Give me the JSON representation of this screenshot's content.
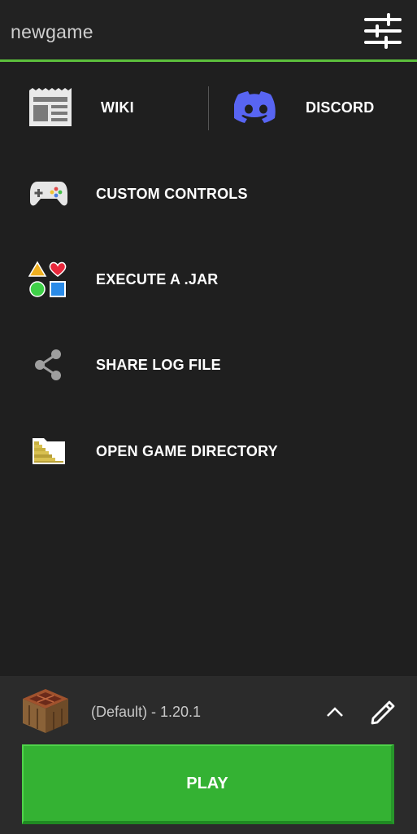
{
  "header": {
    "title": "newgame",
    "settings_icon": "sliders-icon",
    "accent_color": "#5cbf3c"
  },
  "quick_links": {
    "wiki_label": "WIKI",
    "wiki_icon": "newspaper-icon",
    "discord_label": "DISCORD",
    "discord_icon": "discord-icon"
  },
  "menu": [
    {
      "label": "CUSTOM CONTROLS",
      "icon": "gamepad-icon"
    },
    {
      "label": "EXECUTE A .JAR",
      "icon": "shapes-icon"
    },
    {
      "label": "SHARE LOG FILE",
      "icon": "share-icon"
    },
    {
      "label": "OPEN GAME DIRECTORY",
      "icon": "folder-icon"
    }
  ],
  "footer": {
    "version_label": "(Default) - 1.20.1",
    "profile_icon": "crafting-table-icon",
    "expand_icon": "chevron-up-icon",
    "edit_icon": "pencil-icon",
    "play_label": "PLAY",
    "play_color": "#34b233"
  }
}
